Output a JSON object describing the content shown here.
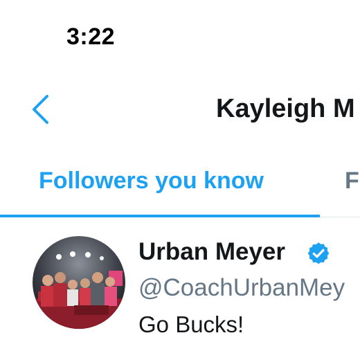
{
  "status_bar": {
    "time": "3:22"
  },
  "nav": {
    "back_icon": "chevron-left-icon",
    "title": "Kayleigh M"
  },
  "tabs": [
    {
      "label": "Followers you know",
      "active": true
    },
    {
      "label": "F",
      "active": false
    }
  ],
  "user": {
    "name": "Urban Meyer",
    "verified": true,
    "handle": "@CoachUrbanMey",
    "bio": "Go Bucks!"
  },
  "colors": {
    "accent": "#1da1f2",
    "secondary_text": "#657786",
    "primary_text": "#14171a"
  }
}
